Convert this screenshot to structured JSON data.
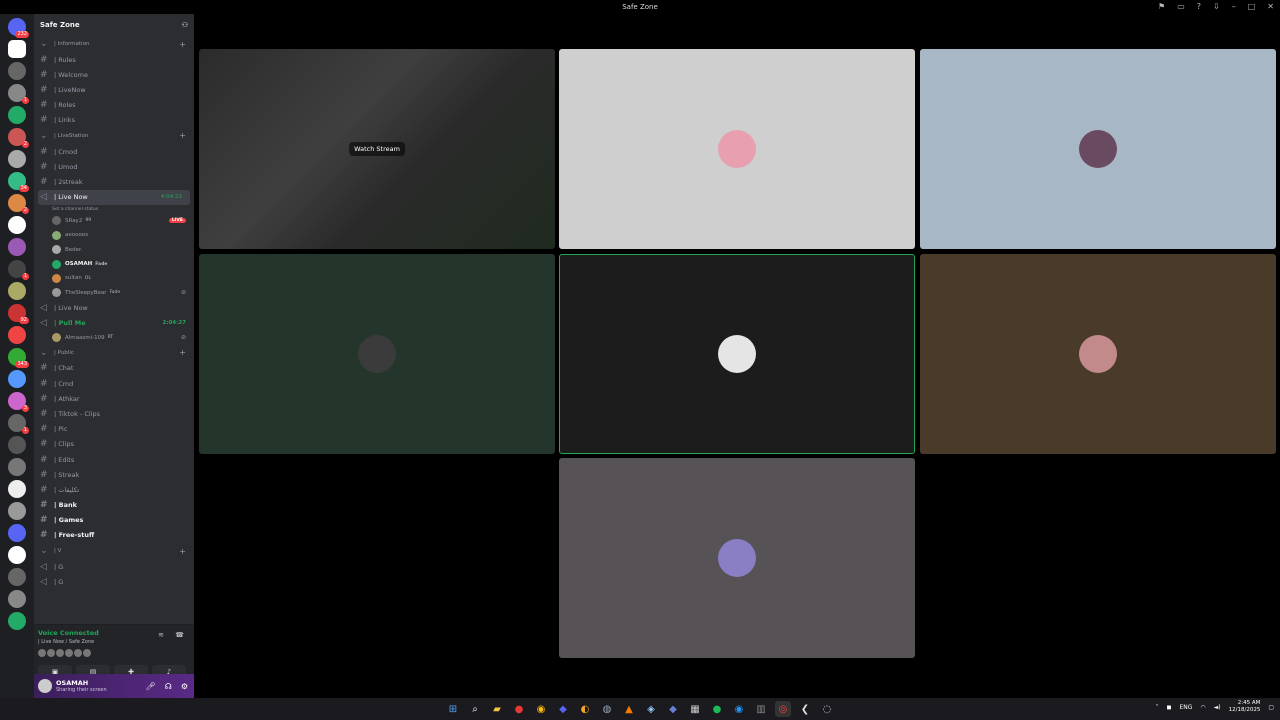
{
  "window": {
    "title": "Safe Zone"
  },
  "rail": {
    "badges": [
      "232",
      "1",
      "2",
      "34",
      "2",
      "1",
      "92",
      "343",
      "3",
      "1"
    ]
  },
  "sidebar": {
    "server_name": "Safe Zone",
    "rows": [
      {
        "kind": "cat",
        "label": "| Information"
      },
      {
        "kind": "chan",
        "label": "| Rules"
      },
      {
        "kind": "chan",
        "label": "| Welcome"
      },
      {
        "kind": "chan",
        "label": "| LiveNow"
      },
      {
        "kind": "chan",
        "label": "| Roles"
      },
      {
        "kind": "chan",
        "label": "| Links"
      },
      {
        "kind": "cat",
        "label": "| LiveStation"
      },
      {
        "kind": "chan",
        "label": "| Cmod"
      },
      {
        "kind": "chan",
        "label": "| Umod"
      },
      {
        "kind": "chan",
        "label": "| 2streak"
      }
    ],
    "live_now": {
      "label": "| Live Now",
      "time": "4:04:22",
      "status": "Set a channel status"
    },
    "voice_users": [
      {
        "name": "SRay2",
        "tag": "99",
        "badge": "LIVE"
      },
      {
        "name": "aeoooos",
        "tag": ""
      },
      {
        "name": "Beder.",
        "tag": ""
      },
      {
        "name": "OSAMAH",
        "tag": "Fade",
        "me": true
      },
      {
        "name": "sultan",
        "tag": "OL"
      },
      {
        "name": "TheSleepyBear",
        "tag": "Fade",
        "muted": true
      }
    ],
    "rows2": [
      {
        "kind": "voice",
        "label": "| Live Now"
      },
      {
        "kind": "voicebold",
        "label": "| Pull Me",
        "time": "2:04:27"
      }
    ],
    "pull_user": {
      "name": "Almaasmi-109",
      "tag": "RT"
    },
    "rows3": [
      {
        "kind": "cat",
        "label": "| Public"
      },
      {
        "kind": "chan",
        "label": "| Chat"
      },
      {
        "kind": "chan",
        "label": "| Cmd"
      },
      {
        "kind": "chan",
        "label": "| Athkar"
      },
      {
        "kind": "chan",
        "label": "| Tiktok - Clips"
      },
      {
        "kind": "chan",
        "label": "| Pic"
      },
      {
        "kind": "chan",
        "label": "| Clips"
      },
      {
        "kind": "chan",
        "label": "| Edits"
      },
      {
        "kind": "chan",
        "label": "| Streak"
      },
      {
        "kind": "chan",
        "label": "| تكليفات"
      },
      {
        "kind": "bold",
        "label": "| Bank"
      },
      {
        "kind": "bold",
        "label": "| Games"
      },
      {
        "kind": "bold",
        "label": "| Free-stuff"
      },
      {
        "kind": "cat",
        "label": "| V"
      },
      {
        "kind": "voice",
        "label": "| G"
      },
      {
        "kind": "voice",
        "label": "| G"
      }
    ]
  },
  "voice_panel": {
    "status": "Voice Connected",
    "location": "| Live Now / Safe Zone"
  },
  "user_panel": {
    "name": "OSAMAH",
    "status": "Sharing their screen"
  },
  "stage": {
    "watch_label": "Watch Stream"
  },
  "tiles": [
    {
      "id": "stream",
      "color": "#3a3a3a"
    },
    {
      "id": "u1",
      "color": "#cfcfcf",
      "av": "#e8a0b0"
    },
    {
      "id": "u2",
      "color": "#a7b7c6",
      "av": "#6a4a60"
    },
    {
      "id": "u3",
      "color": "#24352c",
      "av": "#3b3b3b"
    },
    {
      "id": "u4",
      "color": "#1c1c1c",
      "av": "#e5e5e5",
      "speaking": true
    },
    {
      "id": "u5",
      "color": "#4a3a2a",
      "av": "#c28a8a"
    },
    {
      "id": "u6",
      "color": "#575256",
      "av": "#8a7ec4"
    }
  ],
  "taskbar": {
    "lang": "ENG",
    "time": "2:45 AM",
    "date": "12/18/2025"
  }
}
